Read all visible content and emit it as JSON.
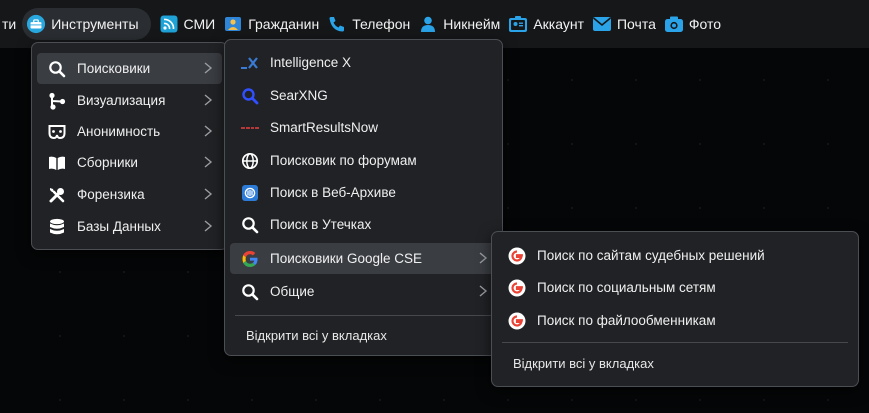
{
  "toolbar": {
    "items": [
      {
        "label": "ти"
      },
      {
        "label": "Инструменты"
      },
      {
        "label": "СМИ"
      },
      {
        "label": "Гражданин"
      },
      {
        "label": "Телефон"
      },
      {
        "label": "Никнейм"
      },
      {
        "label": "Аккаунт"
      },
      {
        "label": "Почта"
      },
      {
        "label": "Фото"
      }
    ]
  },
  "menu_tools": {
    "items": [
      {
        "label": "Поисковики",
        "icon": "search-icon"
      },
      {
        "label": "Визуализация",
        "icon": "network-icon"
      },
      {
        "label": "Анонимность",
        "icon": "mask-icon"
      },
      {
        "label": "Сборники",
        "icon": "book-icon"
      },
      {
        "label": "Форензика",
        "icon": "tools-icon"
      },
      {
        "label": "Базы Данных",
        "icon": "database-icon"
      }
    ]
  },
  "menu_search": {
    "items": [
      {
        "label": "Intelligence X",
        "icon": "intelx-icon"
      },
      {
        "label": "SearXNG",
        "icon": "searxng-icon"
      },
      {
        "label": "SmartResultsNow",
        "icon": "smartresults-icon"
      },
      {
        "label": "Поисковик по форумам",
        "icon": "globe-icon"
      },
      {
        "label": "Поиск в Веб-Архиве",
        "icon": "archive-icon"
      },
      {
        "label": "Поиск в Утечках",
        "icon": "search-icon"
      },
      {
        "label": "Поисковики Google CSE",
        "icon": "google-icon"
      },
      {
        "label": "Общие",
        "icon": "search-icon"
      }
    ],
    "open_all": "Відкрити всі у вкладках"
  },
  "menu_google": {
    "items": [
      {
        "label": "Поиск по сайтам судебных решений",
        "icon": "google-icon"
      },
      {
        "label": "Поиск по социальным сетям",
        "icon": "google-icon"
      },
      {
        "label": "Поиск по файлообменникам",
        "icon": "google-icon"
      }
    ],
    "open_all": "Відкрити всі у вкладках",
    "brand_color": "#4285f4"
  }
}
